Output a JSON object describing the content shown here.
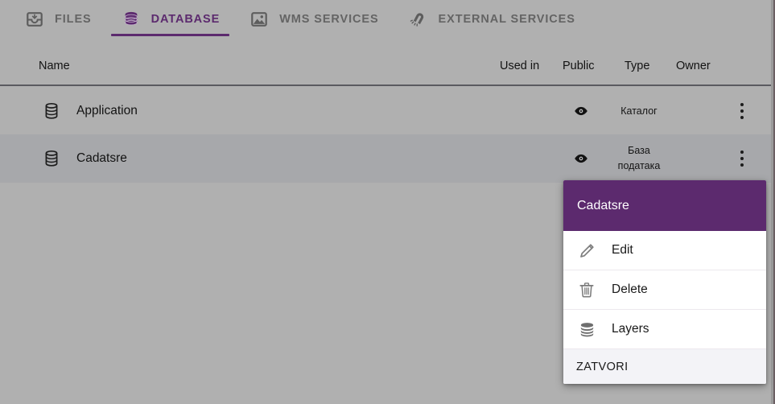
{
  "tabs": [
    {
      "label": "FILES",
      "icon": "inbox-icon",
      "active": false
    },
    {
      "label": "DATABASE",
      "icon": "database-icon",
      "active": true
    },
    {
      "label": "WMS SERVICES",
      "icon": "image-icon",
      "active": false
    },
    {
      "label": "EXTERNAL SERVICES",
      "icon": "magnet-icon",
      "active": false
    }
  ],
  "table": {
    "headers": {
      "name": "Name",
      "used_in": "Used in",
      "public": "Public",
      "type": "Type",
      "owner": "Owner"
    },
    "rows": [
      {
        "name": "Application",
        "icon": "database-icon",
        "public_icon": "eye-icon",
        "type": "Каталог",
        "used_in": "",
        "owner": "",
        "menu_icon": "more-vertical-icon"
      },
      {
        "name": "Cadatsre",
        "icon": "database-icon",
        "public_icon": "eye-icon",
        "type": "База података",
        "used_in": "",
        "owner": "",
        "menu_icon": "more-vertical-icon"
      }
    ]
  },
  "context_menu": {
    "title": "Cadatsre",
    "items": [
      {
        "label": "Edit",
        "icon": "pencil-icon"
      },
      {
        "label": "Delete",
        "icon": "trash-icon"
      },
      {
        "label": "Layers",
        "icon": "layers-icon"
      }
    ],
    "close_label": "ZATVORI"
  },
  "colors": {
    "accent": "#5c2a6e",
    "page_background": "#b0b0b0",
    "row_hover": "#a7a8ab",
    "menu_background": "#ffffff",
    "menu_footer": "#f3f3f7"
  }
}
